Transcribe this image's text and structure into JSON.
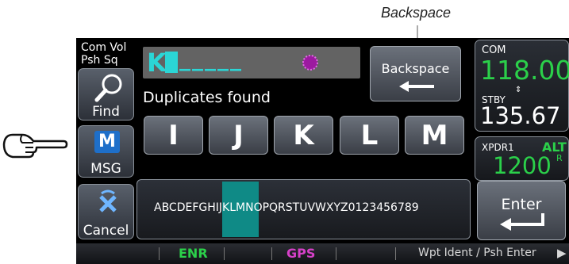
{
  "callouts": {
    "backspace": "Backspace"
  },
  "left_panel": {
    "com_vol": "Com Vol",
    "psh_sq": "Psh Sq",
    "find": "Find",
    "msg": "MSG",
    "cancel": "Cancel"
  },
  "entry": {
    "text": "K",
    "underscores": "_____"
  },
  "duplicates": "Duplicates found",
  "backspace_button": "Backspace",
  "letter_keys": [
    "I",
    "J",
    "K",
    "L",
    "M"
  ],
  "alphabet": {
    "before": "ABCDEFGH",
    "highlight": "IJKLM",
    "after": "NOPQRSTUVWXYZ0123456789"
  },
  "com": {
    "label": "COM",
    "active": "118.00",
    "stby_label": "STBY",
    "standby": "135.67"
  },
  "xpdr": {
    "label": "XPDR1",
    "mode": "ALT",
    "code": "1200",
    "suffix": "R"
  },
  "enter_button": "Enter",
  "status_bar": {
    "enr": "ENR",
    "gps": "GPS",
    "hint": "Wpt Ident / Psh Enter"
  },
  "colors": {
    "active_freq": "#2bd04a",
    "highlight": "#0f8a86",
    "entry": "#2bd6d6"
  }
}
